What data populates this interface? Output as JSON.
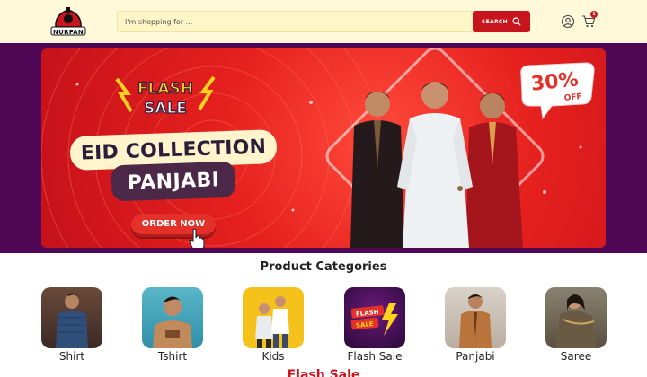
{
  "header": {
    "brand": "NURFAN",
    "search_placeholder": "I'm shopping for ...",
    "search_button": "SEARCH",
    "cart_count": "1",
    "icons": [
      "user-icon",
      "cart-icon",
      "search-icon"
    ]
  },
  "banner": {
    "flash_line1": "FLASH",
    "flash_line2": "SALE",
    "headline": "EID COLLECTION",
    "subheadline": "PANJABI",
    "cta": "ORDER NOW",
    "discount_value": "30%",
    "discount_suffix": "OFF"
  },
  "categories": {
    "title": "Product Categories",
    "items": [
      {
        "label": "Shirt"
      },
      {
        "label": "Tshirt"
      },
      {
        "label": "Kids"
      },
      {
        "label": "Flash Sale"
      },
      {
        "label": "Panjabi"
      },
      {
        "label": "Saree"
      }
    ]
  },
  "flash_section": {
    "title": "Flash Sale"
  },
  "colors": {
    "header_bg": "#fff9d9",
    "accent_red": "#c8141d",
    "banner_frame": "#4f0756"
  }
}
